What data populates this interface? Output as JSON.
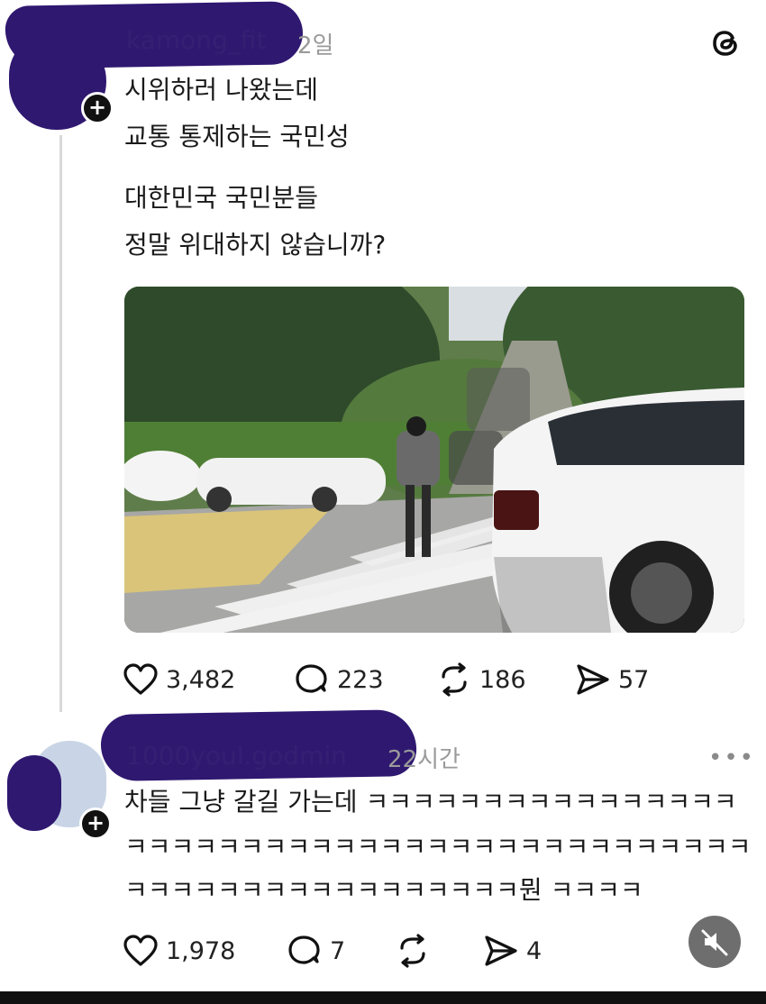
{
  "post": {
    "username": "kamong_fit",
    "time": "2일",
    "lines": [
      "시위하러 나왔는데",
      "교통 통제하는 국민성",
      "대한민국 국민분들",
      "정말 위대하지 않습니까?"
    ],
    "likes": "3,482",
    "comments": "223",
    "reposts": "186",
    "shares": "57"
  },
  "reply": {
    "username": "1000youl.godmin",
    "time": "22시간",
    "lines": [
      "차들 그냥 갈길 가는데 ㅋㅋㅋㅋㅋㅋㅋㅋㅋㅋㅋㅋㅋㅋㅋㅋ",
      "ㅋㅋㅋㅋㅋㅋㅋㅋㅋㅋㅋㅋㅋㅋㅋㅋㅋㅋㅋㅋㅋㅋㅋㅋㅋㅋㅋ",
      "ㅋㅋㅋㅋㅋㅋㅋㅋㅋㅋㅋㅋㅋㅋㅋㅋㅋ뭔 ㅋㅋㅋㅋ"
    ],
    "likes": "1,978",
    "comments": "7",
    "shares": "4"
  },
  "icons": {
    "app_logo": "threads-logo-icon",
    "more": "more-options-icon",
    "heart": "heart-icon",
    "comment": "comment-icon",
    "repost": "repost-icon",
    "share": "share-icon",
    "mute": "muted-speaker-icon"
  }
}
